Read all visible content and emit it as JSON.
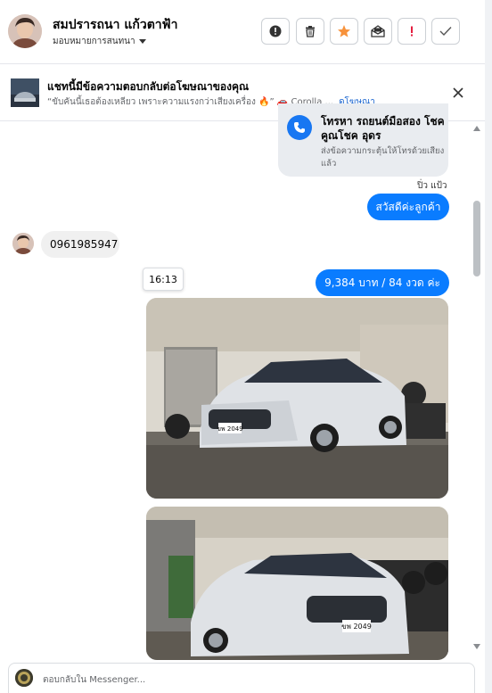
{
  "header": {
    "name": "สมปรารถนา แก้วตาฟ้า",
    "assign_label": "มอบหมายการสนทนา"
  },
  "banner": {
    "title": "แชทนี้มีข้อความตอบกลับต่อโฆษณาของคุณ",
    "ad_text": "“ขับคันนี้เธอต้องเหลียว เพราะความแรงกว่าเสียงเครื่อง 🔥” 🚗 Corolla ...",
    "view_ad_link": "ดูโฆษณา"
  },
  "card": {
    "title": "โทรหา รถยนต์มือสอง โชคคูณโชค อุดร",
    "desc": "ส่งข้อความกระตุ้นให้โทรด้วยเสียงแล้ว"
  },
  "messages": {
    "sender_name": "ปิ่ว แป้ว",
    "greeting": "สวัสดีค่ะลูกค้า",
    "customer_phone": "0961985947",
    "timestamp": "16:13",
    "price": "9,384 บาท  / 84 งวด  ค่ะ",
    "plate1": "ขพ 2049",
    "plate2": "ขพ 2049"
  },
  "composer": {
    "placeholder": "ตอบกลับใน Messenger..."
  },
  "colors": {
    "accent": "#0a7cff",
    "star": "#f7923b",
    "alert": "#e41e3f"
  }
}
